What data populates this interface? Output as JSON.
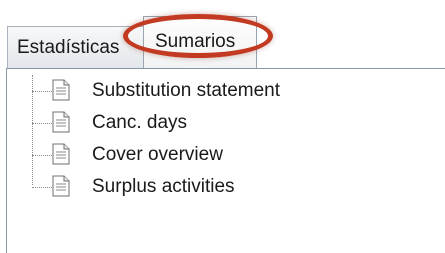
{
  "tabs": [
    {
      "label": "Estadísticas"
    },
    {
      "label": "Sumarios"
    }
  ],
  "tree": {
    "items": [
      {
        "label": "Substitution statement",
        "icon": "document-icon"
      },
      {
        "label": "Canc. days",
        "icon": "document-icon"
      },
      {
        "label": "Cover overview",
        "icon": "document-icon"
      },
      {
        "label": "Surplus activities",
        "icon": "document-icon"
      }
    ]
  },
  "colors": {
    "highlight": "#c23a22",
    "tab_border": "#a9b2bd",
    "panel_border": "#8b97a3"
  }
}
